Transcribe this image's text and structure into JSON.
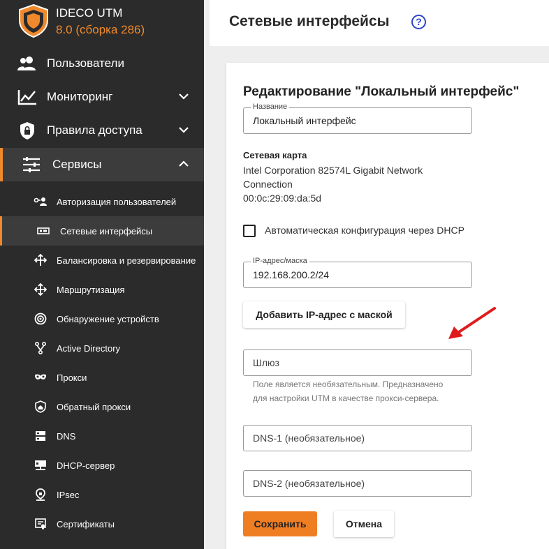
{
  "brand": {
    "name": "IDECO UTM",
    "version": "8.0 (сборка 286)",
    "accent": "#f0892b"
  },
  "nav": [
    {
      "label": "Пользователи",
      "icon": "users-icon"
    },
    {
      "label": "Мониторинг",
      "icon": "chart-icon"
    },
    {
      "label": "Правила доступа",
      "icon": "shield-lock-icon"
    },
    {
      "label": "Сервисы",
      "icon": "sliders-icon"
    }
  ],
  "submenu": [
    {
      "label": "Авторизация пользователей",
      "icon": "user-key-icon"
    },
    {
      "label": "Сетевые интерфейсы",
      "icon": "network-card-icon"
    },
    {
      "label": "Балансировка и резервирование",
      "icon": "arrows-split-icon"
    },
    {
      "label": "Маршрутизация",
      "icon": "move-arrows-icon"
    },
    {
      "label": "Обнаружение устройств",
      "icon": "radar-icon"
    },
    {
      "label": "Active Directory",
      "icon": "hierarchy-icon"
    },
    {
      "label": "Прокси",
      "icon": "mask-icon"
    },
    {
      "label": "Обратный прокси",
      "icon": "home-shield-icon"
    },
    {
      "label": "DNS",
      "icon": "server-icon"
    },
    {
      "label": "DHCP-сервер",
      "icon": "dhcp-icon"
    },
    {
      "label": "IPsec",
      "icon": "location-lock-icon"
    },
    {
      "label": "Сертификаты",
      "icon": "certificate-icon"
    }
  ],
  "header": {
    "title": "Сетевые интерфейсы",
    "help": "?"
  },
  "form": {
    "title": "Редактирование \"Локальный интерфейс\"",
    "name_label": "Название",
    "name_value": "Локальный интерфейс",
    "card_label": "Сетевая карта",
    "card_line1": "Intel Corporation 82574L Gigabit Network",
    "card_line2": "Connection",
    "card_mac": "00:0c:29:09:da:5d",
    "dhcp_label": "Автоматическая конфигурация через DHCP",
    "ip_label": "IP-адрес/маска",
    "ip_value": "192.168.200.2/24",
    "add_ip_button": "Добавить IP-адрес с маской",
    "gateway_placeholder": "Шлюз",
    "gateway_hint1": "Поле является необязательным. Предназначено",
    "gateway_hint2": "для настройки UTM в качестве прокси-сервера.",
    "dns1_placeholder": "DNS-1 (необязательное)",
    "dns2_placeholder": "DNS-2 (необязательное)",
    "save_button": "Сохранить",
    "cancel_button": "Отмена"
  }
}
